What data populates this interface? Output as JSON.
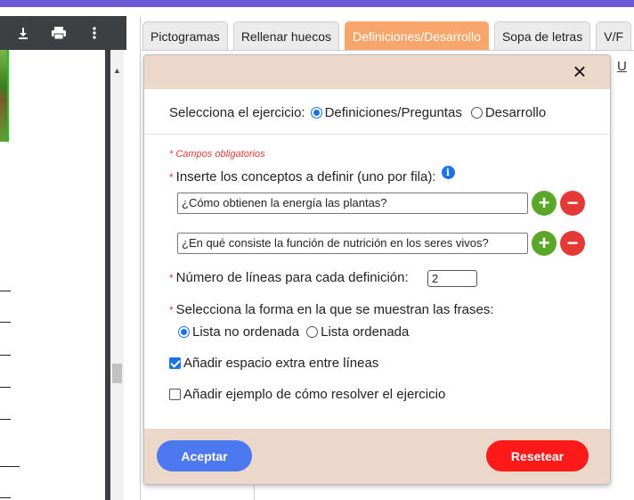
{
  "editor": {
    "tabs": [
      "Pictogramas",
      "Rellenar huecos",
      "Definiciones/Desarrollo",
      "Sopa de letras",
      "V/F"
    ],
    "active_tab": "Definiciones/Desarrollo",
    "underline_button": "U"
  },
  "pdf_viewer": {
    "icons": [
      "download-icon",
      "print-icon",
      "more-vert-icon"
    ]
  },
  "modal": {
    "close_icon": "×",
    "select_label": "Selecciona el ejercicio:",
    "exercise_options": [
      "Definiciones/Preguntas",
      "Desarrollo"
    ],
    "exercise_selected": "Definiciones/Preguntas",
    "required_note": "* Campos obligatorios",
    "concepts_label": "Inserte los conceptos a definir (uno por fila):",
    "info_icon": "i",
    "concepts": [
      "¿Cómo obtienen la energía las plantas?",
      "¿En qué consiste la función de nutrición en los seres vivos?"
    ],
    "add_symbol": "+",
    "remove_symbol": "−",
    "lines_label": "Número de líneas para cada definición:",
    "lines_value": "2",
    "format_label": "Selecciona la forma en la que se muestran las frases:",
    "format_options": [
      "Lista no ordenada",
      "Lista ordenada"
    ],
    "format_selected": "Lista no ordenada",
    "extra_space_label": "Añadir espacio extra entre líneas",
    "extra_space_checked": true,
    "example_label": "Añadir ejemplo de cómo resolver el ejercicio",
    "example_checked": false,
    "accept_button": "Aceptar",
    "reset_button": "Resetear"
  },
  "colors": {
    "accent_tab": "#f8a66b",
    "modal_band": "#ecd8cb",
    "accept": "#4d79f0",
    "reset": "#ff1a1a",
    "add": "#5aa72a",
    "remove": "#e53935"
  }
}
